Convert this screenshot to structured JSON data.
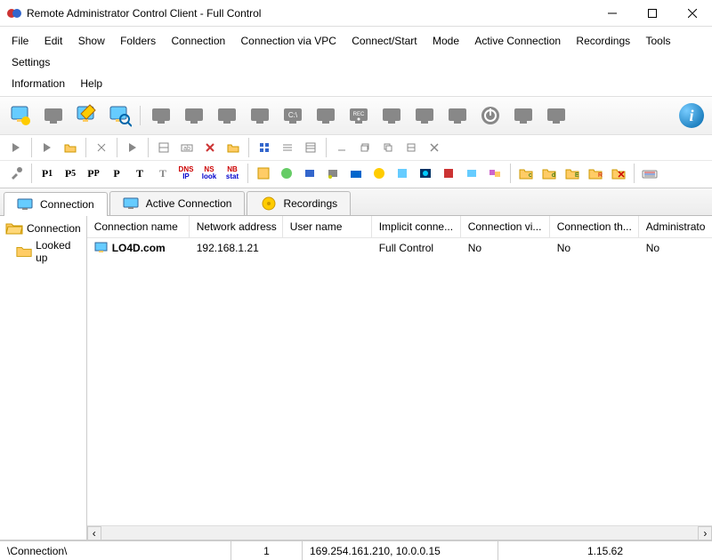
{
  "window": {
    "title": "Remote Administrator Control Client - Full Control"
  },
  "menu": {
    "file": "File",
    "edit": "Edit",
    "show": "Show",
    "folders": "Folders",
    "connection": "Connection",
    "connection_vpc": "Connection via VPC",
    "connect_start": "Connect/Start",
    "mode": "Mode",
    "active_connection": "Active Connection",
    "recordings": "Recordings",
    "tools": "Tools",
    "settings": "Settings",
    "information": "Information",
    "help": "Help"
  },
  "toolbar3": {
    "p1": "P₁",
    "p5": "P₅",
    "pp": "P_P",
    "p": "P",
    "t1": "T",
    "t2": "T",
    "dns": "DNS IP",
    "ns": "NS look",
    "nb": "NB stat"
  },
  "toolbar1_label_c": "C:\\",
  "toolbar1_label_rec": "REC",
  "tabs": {
    "connection": "Connection",
    "active_connection": "Active Connection",
    "recordings": "Recordings"
  },
  "tree": {
    "connection": "Connection",
    "looked_up": "Looked up"
  },
  "grid": {
    "columns": {
      "name": "Connection name",
      "address": "Network address",
      "user": "User name",
      "implicit": "Implicit conne...",
      "via": "Connection vi...",
      "thru": "Connection th...",
      "admin": "Administrato"
    },
    "rows": [
      {
        "name": "LO4D.com",
        "address": "192.168.1.21",
        "user": "",
        "implicit": "Full Control",
        "via": "No",
        "thru": "No",
        "admin": "No"
      }
    ]
  },
  "status": {
    "path": "\\Connection\\",
    "count": "1",
    "ips": "169.254.161.210, 10.0.0.15",
    "version": "1.15.62"
  },
  "colors": {
    "monitor_gray": "#8a8a8a",
    "accent_blue": "#3a78c8"
  }
}
